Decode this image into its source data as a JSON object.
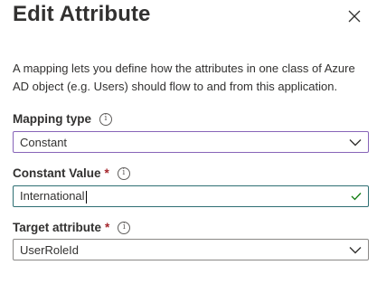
{
  "panel": {
    "title": "Edit Attribute",
    "description": "A mapping lets you define how the attributes in one class of Azure AD object (e.g. Users) should flow to and from this application."
  },
  "fields": {
    "mapping_type": {
      "label": "Mapping type",
      "value": "Constant"
    },
    "constant_value": {
      "label": "Constant Value",
      "required_mark": "*",
      "value": "International"
    },
    "target_attribute": {
      "label": "Target attribute",
      "required_mark": "*",
      "value": "UserRoleId"
    }
  },
  "icons": {
    "info": "info-icon",
    "close": "close-icon",
    "dropdown": "chevron-down-icon",
    "valid": "checkmark-icon"
  },
  "colors": {
    "required": "#a4262c",
    "mapping_border": "#8764b8",
    "constant_border": "#2f6f73",
    "check": "#107c10"
  }
}
